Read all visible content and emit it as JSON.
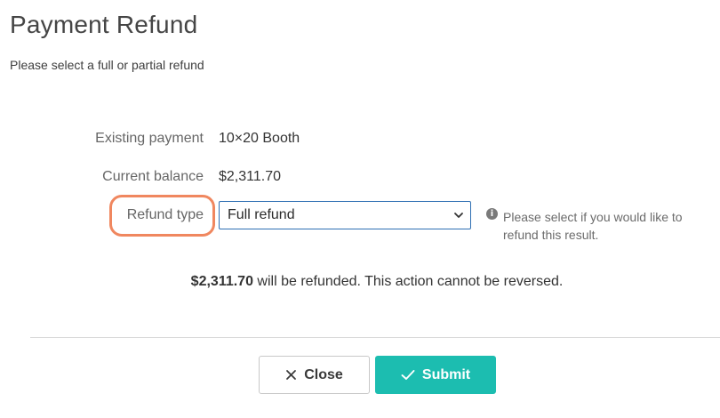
{
  "header": {
    "title": "Payment Refund",
    "subtitle": "Please select a full or partial refund"
  },
  "form": {
    "existing_payment": {
      "label": "Existing payment",
      "value": "10×20 Booth"
    },
    "current_balance": {
      "label": "Current balance",
      "value": "$2,311.70"
    },
    "refund_type": {
      "label": "Refund type",
      "selected": "Full refund",
      "hint": "Please select if you would like to refund this result."
    }
  },
  "notice": {
    "amount": "$2,311.70",
    "text": " will be refunded. This action cannot be reversed."
  },
  "footer": {
    "close_label": "Close",
    "submit_label": "Submit"
  },
  "icons": {
    "info": "info-icon",
    "select_arrow": "chevron-down-icon",
    "close": "close-icon",
    "submit": "check-icon"
  },
  "colors": {
    "accent": "#1cbdb0",
    "highlight": "#f0875f",
    "select_border": "#2f6fb3"
  }
}
